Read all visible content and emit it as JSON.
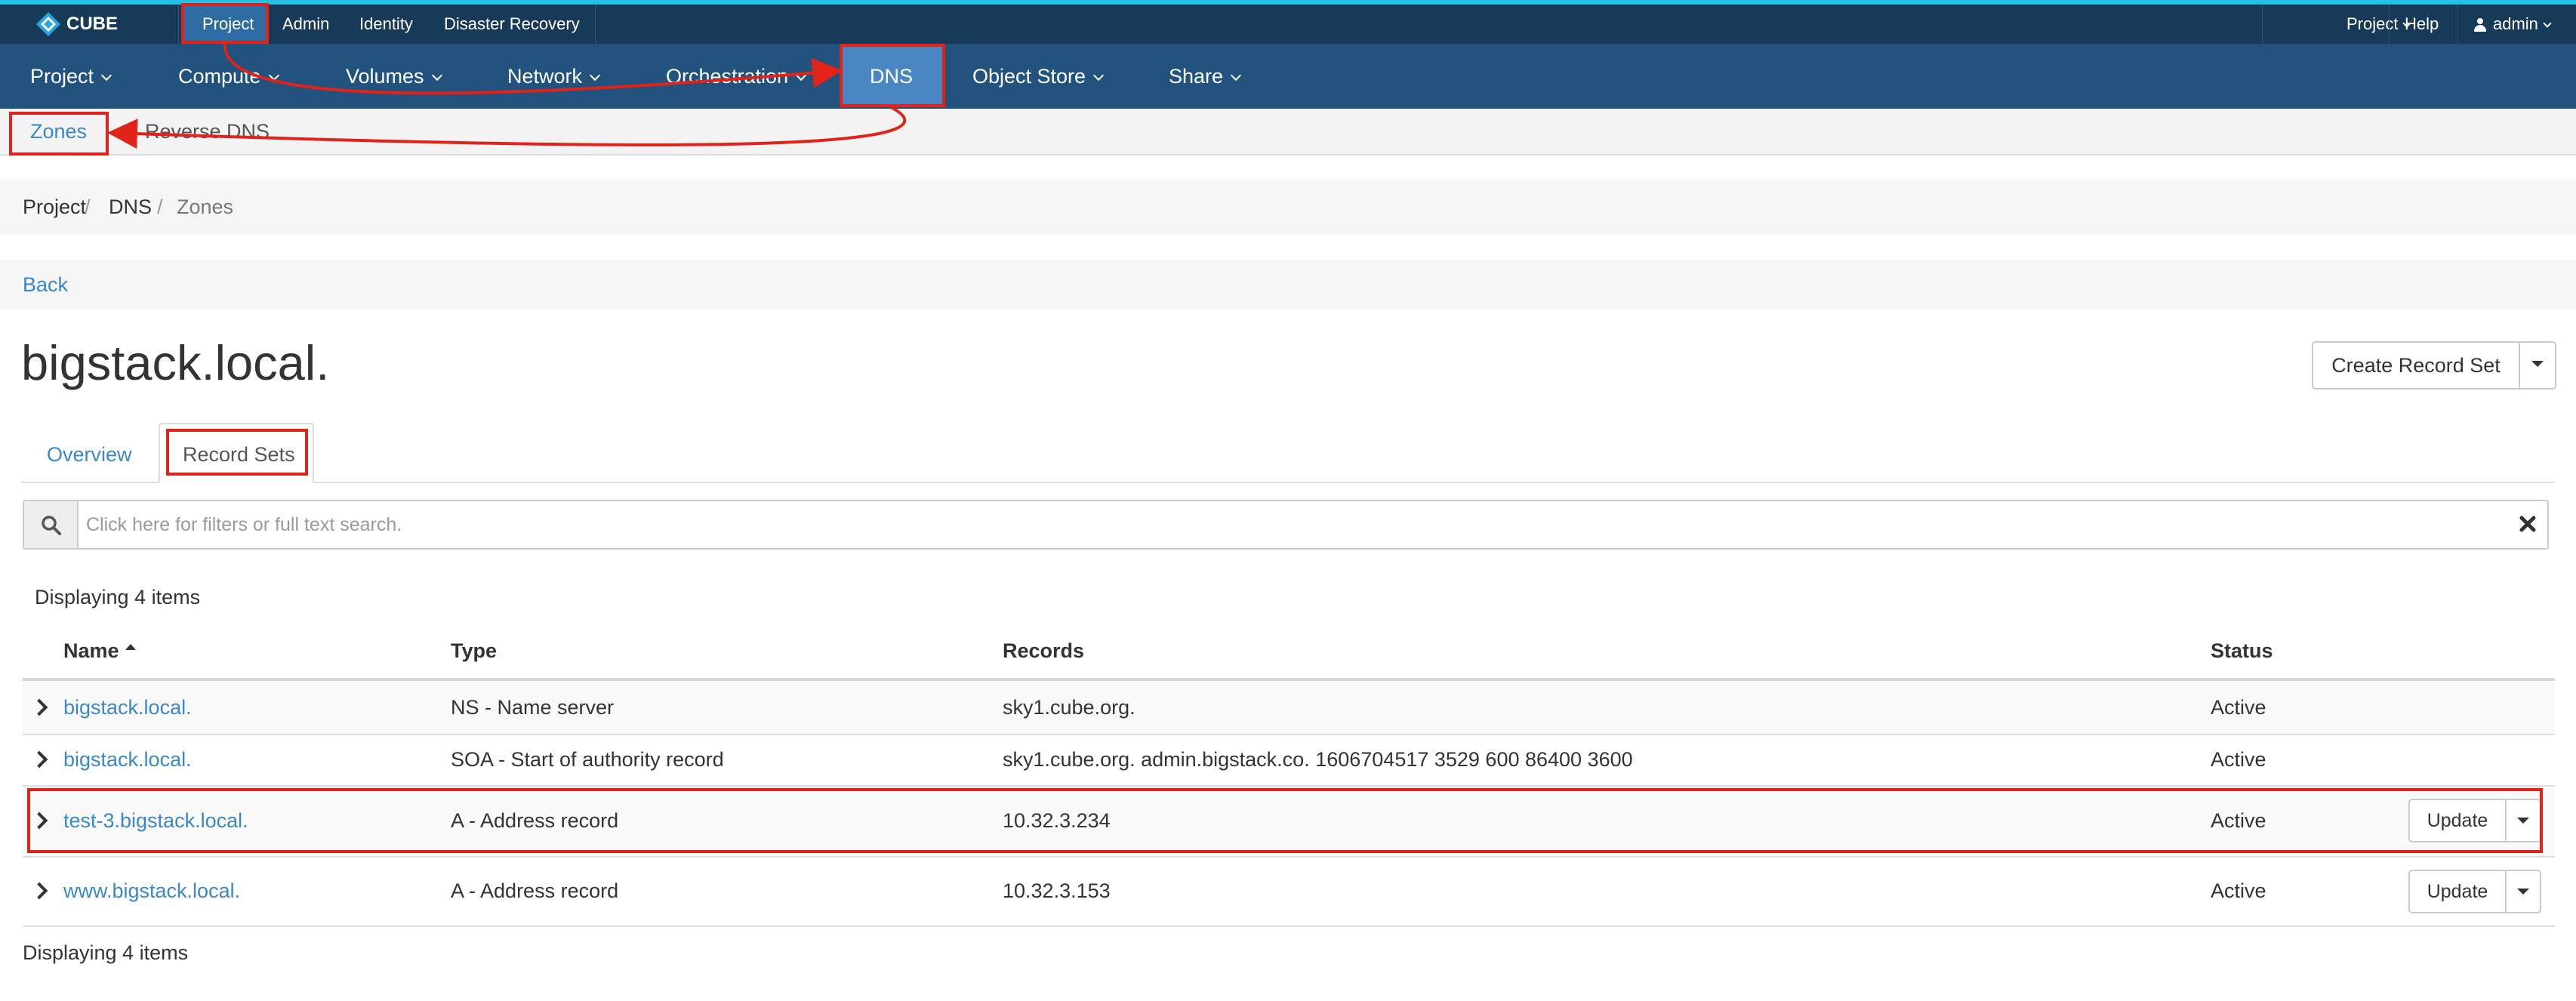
{
  "brand": {
    "name": "CUBE",
    "accent": "#29c0e6",
    "topbar_bg": "#173a58",
    "nav_bg": "#22527e"
  },
  "topbar": {
    "items": [
      "Project",
      "Admin",
      "Identity",
      "Disaster Recovery"
    ],
    "right": {
      "project": "Project",
      "help": "Help",
      "user": "admin"
    }
  },
  "mainnav": {
    "items": [
      "Project",
      "Compute",
      "Volumes",
      "Network",
      "Orchestration",
      "DNS",
      "Object Store",
      "Share"
    ],
    "active": "DNS"
  },
  "subnav": {
    "items": [
      "Zones",
      "Reverse DNS"
    ],
    "active": "Zones"
  },
  "breadcrumb": [
    "Project",
    "DNS",
    "Zones"
  ],
  "back_label": "Back",
  "page_title": "bigstack.local.",
  "actions": {
    "create_record_set": "Create Record Set"
  },
  "tabs": [
    "Overview",
    "Record Sets"
  ],
  "search": {
    "placeholder": "Click here for filters or full text search."
  },
  "table": {
    "count_text": "Displaying 4 items",
    "headers": {
      "name": "Name",
      "type": "Type",
      "records": "Records",
      "status": "Status"
    },
    "rows": [
      {
        "name": "bigstack.local.",
        "type": "NS - Name server",
        "records": "sky1.cube.org.",
        "status": "Active",
        "action": ""
      },
      {
        "name": "bigstack.local.",
        "type": "SOA - Start of authority record",
        "records": "sky1.cube.org. admin.bigstack.co. 1606704517 3529 600 86400 3600",
        "status": "Active",
        "action": ""
      },
      {
        "name": "test-3.bigstack.local.",
        "type": "A - Address record",
        "records": "10.32.3.234",
        "status": "Active",
        "action": "Update"
      },
      {
        "name": "www.bigstack.local.",
        "type": "A - Address record",
        "records": "10.32.3.153",
        "status": "Active",
        "action": "Update"
      }
    ]
  },
  "annotation_color": "#e2231a"
}
